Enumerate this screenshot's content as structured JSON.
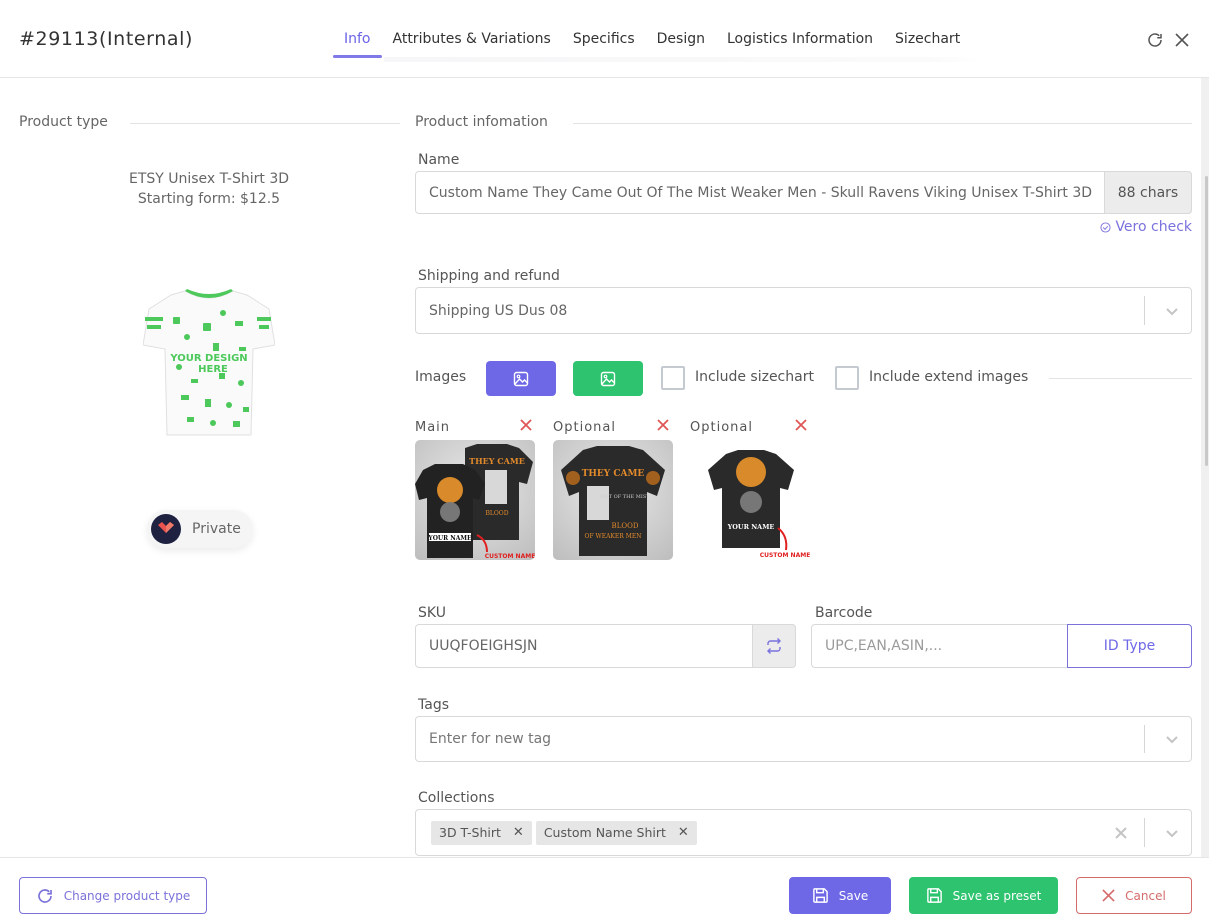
{
  "header": {
    "title": "#29113(Internal)",
    "tabs": [
      {
        "label": "Info",
        "active": true
      },
      {
        "label": "Attributes & Variations",
        "active": false
      },
      {
        "label": "Specifics",
        "active": false
      },
      {
        "label": "Design",
        "active": false
      },
      {
        "label": "Logistics Information",
        "active": false
      },
      {
        "label": "Sizechart",
        "active": false
      }
    ],
    "icons": [
      "refresh-icon",
      "close-icon"
    ]
  },
  "left": {
    "section_title": "Product type",
    "product_type_name": "ETSY Unisex T-Shirt 3D",
    "starting_price": "Starting form: $12.5",
    "preview_image": "tshirt-mockup-your-design-here",
    "visibility_label": "Private"
  },
  "right": {
    "section_title": "Product infomation",
    "name": {
      "label": "Name",
      "value": "Custom Name They Came Out Of The Mist Weaker Men - Skull Ravens Viking Unisex T-Shirt 3D",
      "char_count": "88 chars",
      "vero_check": "Vero check"
    },
    "shipping": {
      "label": "Shipping and refund",
      "value": "Shipping US Dus 08"
    },
    "images": {
      "label": "Images",
      "include_sizechart": {
        "label": "Include sizechart",
        "checked": false
      },
      "include_extend": {
        "label": "Include extend images",
        "checked": false
      },
      "items": [
        {
          "label": "Main",
          "alt": "Viking skull raven shirt front and back"
        },
        {
          "label": "Optional",
          "alt": "They came out of the mist shirt back"
        },
        {
          "label": "Optional",
          "alt": "Skull raven shirt front with custom name"
        }
      ]
    },
    "sku": {
      "label": "SKU",
      "value": "UUQFOEIGHSJN"
    },
    "barcode": {
      "label": "Barcode",
      "placeholder": "UPC,EAN,ASIN,...",
      "id_type_label": "ID Type"
    },
    "tags": {
      "label": "Tags",
      "placeholder": "Enter for new tag"
    },
    "collections": {
      "label": "Collections",
      "chips": [
        "3D T-Shirt",
        "Custom Name Shirt"
      ]
    }
  },
  "footer": {
    "change_type": "Change product type",
    "save": "Save",
    "save_preset": "Save as preset",
    "cancel": "Cancel"
  },
  "colors": {
    "accent": "#6f68e6",
    "green": "#2dc36f",
    "danger": "#d56b6b"
  }
}
